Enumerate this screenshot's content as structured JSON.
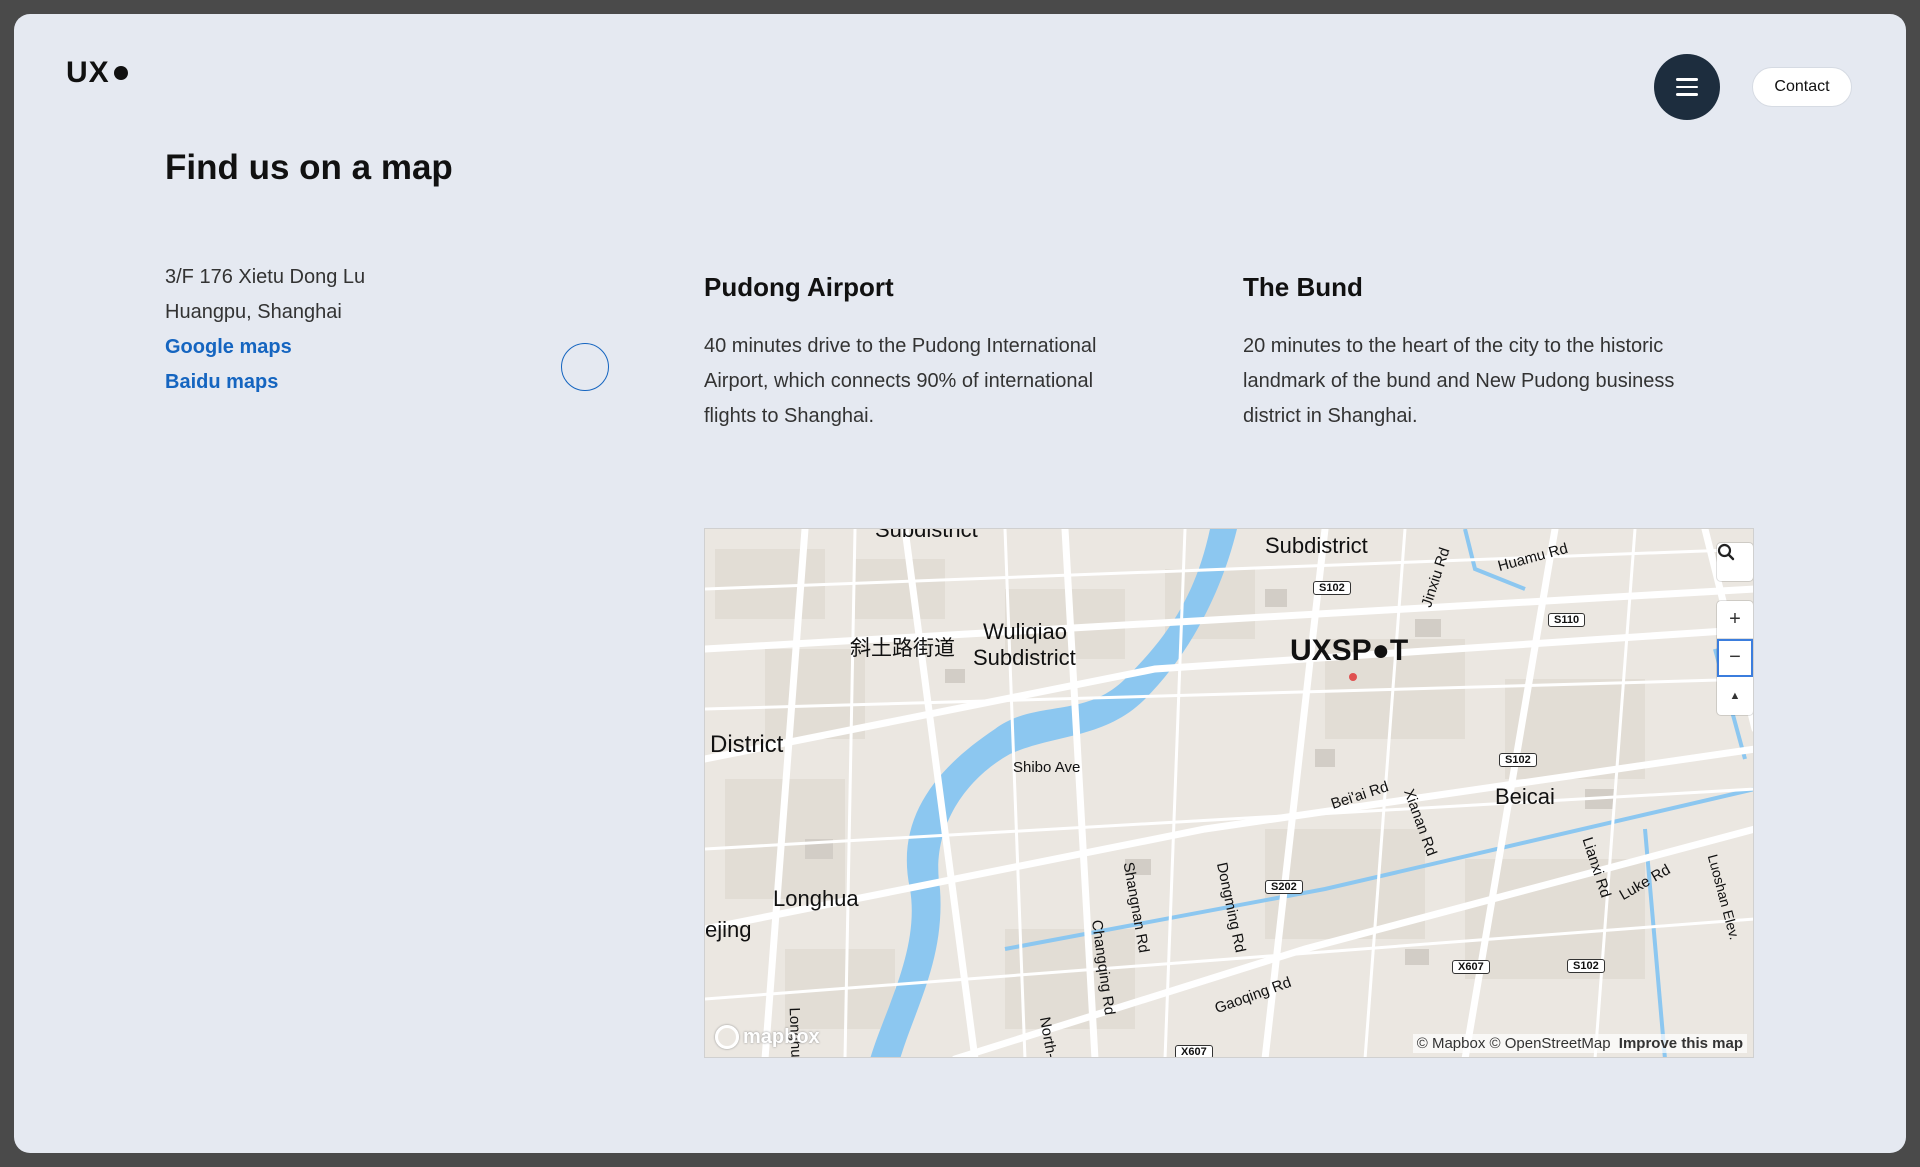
{
  "header": {
    "logo": "UX",
    "contact_label": "Contact"
  },
  "page": {
    "title": "Find us on a map"
  },
  "address": {
    "line1": "3/F 176 Xietu Dong Lu",
    "line2": "Huangpu, Shanghai",
    "google": "Google maps",
    "baidu": "Baidu maps"
  },
  "columns": [
    {
      "title": "Pudong Airport",
      "text": "40 minutes drive to the Pudong International Airport, which connects 90% of international flights to Shanghai."
    },
    {
      "title": "The Bund",
      "text": "20 minutes to the heart of the city to the historic landmark of the bund and New Pudong business district in Shanghai."
    }
  ],
  "map": {
    "labels": {
      "subdistrict_top_left": "Subdistrict",
      "subdistrict_top": "Subdistrict",
      "chinese": "斜土路街道",
      "wuliqiao": "Wuliqiao",
      "wuliqiao_sub": "Subdistrict",
      "district": "District",
      "longhua": "Longhua",
      "beijing_partial": "ejing",
      "beicai": "Beicai",
      "uxspot": "UXSP●T",
      "shibo": "Shibo Ave",
      "beiai": "Bei'ai Rd",
      "xianan": "Xianan Rd",
      "jinxiu": "Jinxiu Rd",
      "huamu": "Huamu Rd",
      "shangnan": "Shangnan Rd",
      "dongming": "Dongming Rd",
      "changqing": "Changqing Rd",
      "gaoqing": "Gaoqing Rd",
      "lianxi": "Lianxi Rd",
      "luke": "Luke Rd",
      "luoshan": "Luoshan Elev.",
      "long_partial": "Longhu",
      "north_partial": "North-S"
    },
    "shields": [
      "S102",
      "S110",
      "S102",
      "S202",
      "X607",
      "S102",
      "X607"
    ],
    "attribution": "© Mapbox © OpenStreetMap",
    "improve": "Improve this map",
    "mapbox_logo": "mapbox",
    "zoom_in": "+",
    "zoom_out": "−",
    "compass": "▲"
  },
  "colors": {
    "accent_link": "#1565c0",
    "menu_button": "#1d2d3e",
    "water": "#8cc7f0",
    "land": "#ebe7e1"
  },
  "icons": {
    "menu": "hamburger-icon",
    "search": "search-icon",
    "compass": "compass-icon"
  }
}
